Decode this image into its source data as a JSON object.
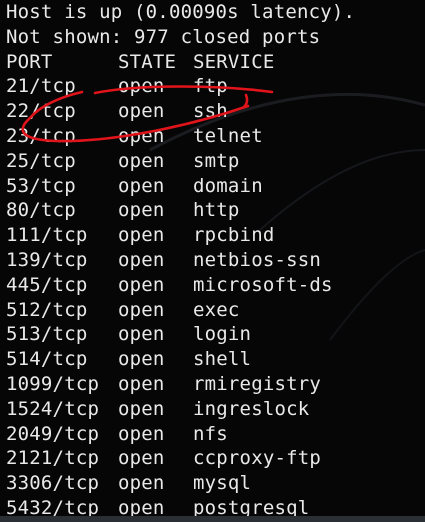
{
  "terminal": {
    "status_line": "Host is up (0.00090s latency).",
    "not_shown_line": "Not shown: 977 closed ports",
    "headers": {
      "port": "PORT",
      "state": "STATE",
      "service": "SERVICE"
    },
    "rows": [
      {
        "port": "21/tcp",
        "state": "open",
        "service": "ftp"
      },
      {
        "port": "22/tcp",
        "state": "open",
        "service": "ssh"
      },
      {
        "port": "23/tcp",
        "state": "open",
        "service": "telnet"
      },
      {
        "port": "25/tcp",
        "state": "open",
        "service": "smtp"
      },
      {
        "port": "53/tcp",
        "state": "open",
        "service": "domain"
      },
      {
        "port": "80/tcp",
        "state": "open",
        "service": "http"
      },
      {
        "port": "111/tcp",
        "state": "open",
        "service": "rpcbind"
      },
      {
        "port": "139/tcp",
        "state": "open",
        "service": "netbios-ssn"
      },
      {
        "port": "445/tcp",
        "state": "open",
        "service": "microsoft-ds"
      },
      {
        "port": "512/tcp",
        "state": "open",
        "service": "exec"
      },
      {
        "port": "513/tcp",
        "state": "open",
        "service": "login"
      },
      {
        "port": "514/tcp",
        "state": "open",
        "service": "shell"
      },
      {
        "port": "1099/tcp",
        "state": "open",
        "service": "rmiregistry"
      },
      {
        "port": "1524/tcp",
        "state": "open",
        "service": "ingreslock"
      },
      {
        "port": "2049/tcp",
        "state": "open",
        "service": "nfs"
      },
      {
        "port": "2121/tcp",
        "state": "open",
        "service": "ccproxy-ftp"
      },
      {
        "port": "3306/tcp",
        "state": "open",
        "service": "mysql"
      },
      {
        "port": "5432/tcp",
        "state": "open",
        "service": "postgresql"
      }
    ]
  },
  "colors": {
    "background": "#060607",
    "text": "#e9e9e9",
    "annotation": "#e0141a"
  }
}
